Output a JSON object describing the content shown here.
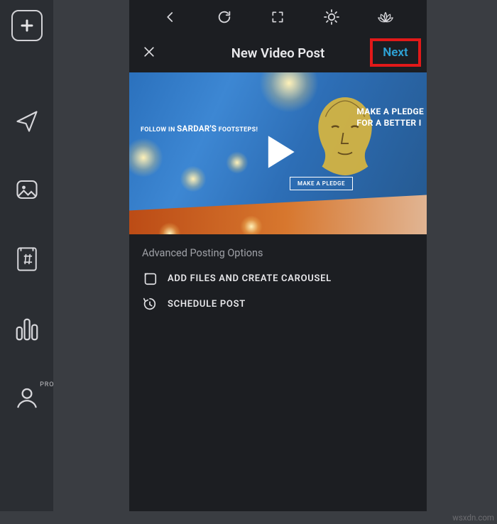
{
  "sidebar": {
    "pro_badge": "PRO"
  },
  "topbar": {},
  "header": {
    "title": "New Video Post",
    "next_label": "Next"
  },
  "video": {
    "follow_prefix": "FOLLOW IN",
    "follow_name": "SARDAR'S",
    "follow_suffix": "FOOTSTEPS!",
    "pledge_line1": "MAKE A PLEDGE",
    "pledge_line2": "FOR A BETTER I",
    "pledge_button": "MAKE A PLEDGE"
  },
  "advanced": {
    "title": "Advanced Posting Options",
    "carousel": "ADD FILES AND CREATE CAROUSEL",
    "schedule": "SCHEDULE POST"
  },
  "watermark": "wsxdn.com"
}
